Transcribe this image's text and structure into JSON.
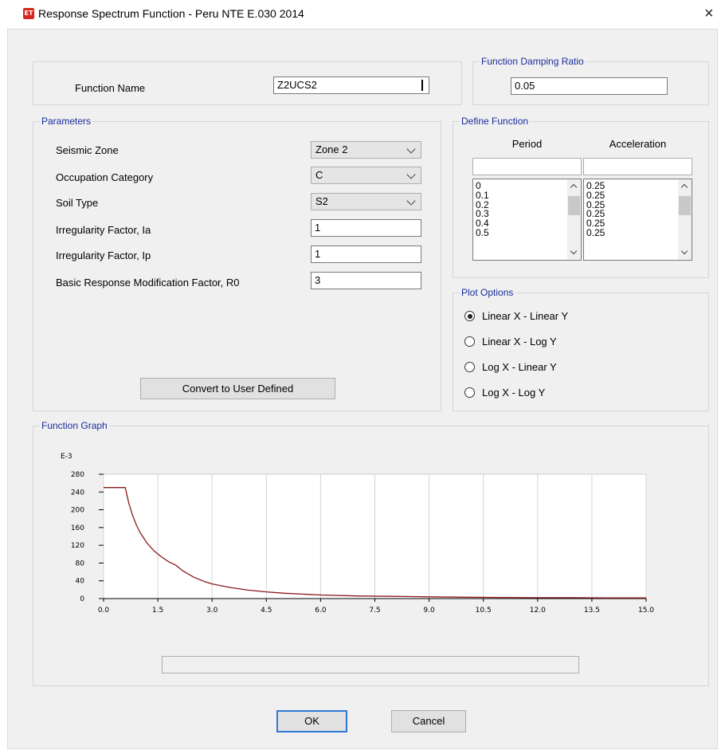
{
  "window": {
    "title": "Response Spectrum Function - Peru NTE E.030 2014",
    "app_icon_text": "ET",
    "close_glyph": "×"
  },
  "function_name": {
    "label": "Function Name",
    "value": "Z2UCS2"
  },
  "damping": {
    "group_title": "Function Damping Ratio",
    "value": "0.05"
  },
  "parameters": {
    "group_title": "Parameters",
    "seismic_zone": {
      "label": "Seismic Zone",
      "value": "Zone 2"
    },
    "occupation_category": {
      "label": "Occupation Category",
      "value": "C"
    },
    "soil_type": {
      "label": "Soil Type",
      "value": "S2"
    },
    "irregularity_ia": {
      "label": "Irregularity Factor, Ia",
      "value": "1"
    },
    "irregularity_ip": {
      "label": "Irregularity Factor, Ip",
      "value": "1"
    },
    "r0": {
      "label": "Basic Response Modification Factor, R0",
      "value": "3"
    },
    "convert_button": "Convert to User Defined"
  },
  "define_function": {
    "group_title": "Define Function",
    "period_header": "Period",
    "acceleration_header": "Acceleration",
    "periods": [
      "0",
      "0.1",
      "0.2",
      "0.3",
      "0.4",
      "0.5"
    ],
    "accelerations": [
      "0.25",
      "0.25",
      "0.25",
      "0.25",
      "0.25",
      "0.25"
    ]
  },
  "plot_options": {
    "group_title": "Plot Options",
    "options": [
      {
        "label": "Linear X - Linear Y",
        "selected": true
      },
      {
        "label": "Linear X - Log Y",
        "selected": false
      },
      {
        "label": "Log X - Linear Y",
        "selected": false
      },
      {
        "label": "Log X - Log Y",
        "selected": false
      }
    ]
  },
  "function_graph": {
    "group_title": "Function Graph",
    "status_text": ""
  },
  "chart_data": {
    "type": "line",
    "y_multiplier_label": "E-3",
    "x_ticks": [
      "0.0",
      "1.5",
      "3.0",
      "4.5",
      "6.0",
      "7.5",
      "9.0",
      "10.5",
      "12.0",
      "13.5",
      "15.0"
    ],
    "y_ticks": [
      "280",
      "240",
      "200",
      "160",
      "120",
      "80",
      "40",
      "0"
    ],
    "xlim": [
      0,
      15
    ],
    "ylim": [
      0,
      280
    ],
    "grid": true,
    "line_color": "#8b1a1a",
    "series": [
      {
        "x": [
          0,
          0.1,
          0.2,
          0.3,
          0.4,
          0.5,
          0.6,
          0.7,
          0.8,
          0.9,
          1.0,
          1.2,
          1.4,
          1.6,
          1.8,
          2.0,
          2.2,
          2.5,
          2.8,
          3.0,
          3.5,
          4.0,
          4.5,
          5.0,
          6.0,
          7.0,
          8.0,
          9.0,
          10.0,
          11.0,
          12.0,
          13.0,
          14.0,
          15.0
        ],
        "y": [
          250,
          250,
          250,
          250,
          250,
          250,
          250,
          214,
          188,
          167,
          150,
          125,
          107,
          94,
          83,
          75,
          62,
          48,
          38,
          33,
          25,
          19,
          15,
          12,
          8,
          6,
          5,
          4,
          3,
          2.5,
          2,
          2,
          1.5,
          1.5
        ]
      }
    ]
  },
  "buttons": {
    "ok": "OK",
    "cancel": "Cancel"
  }
}
